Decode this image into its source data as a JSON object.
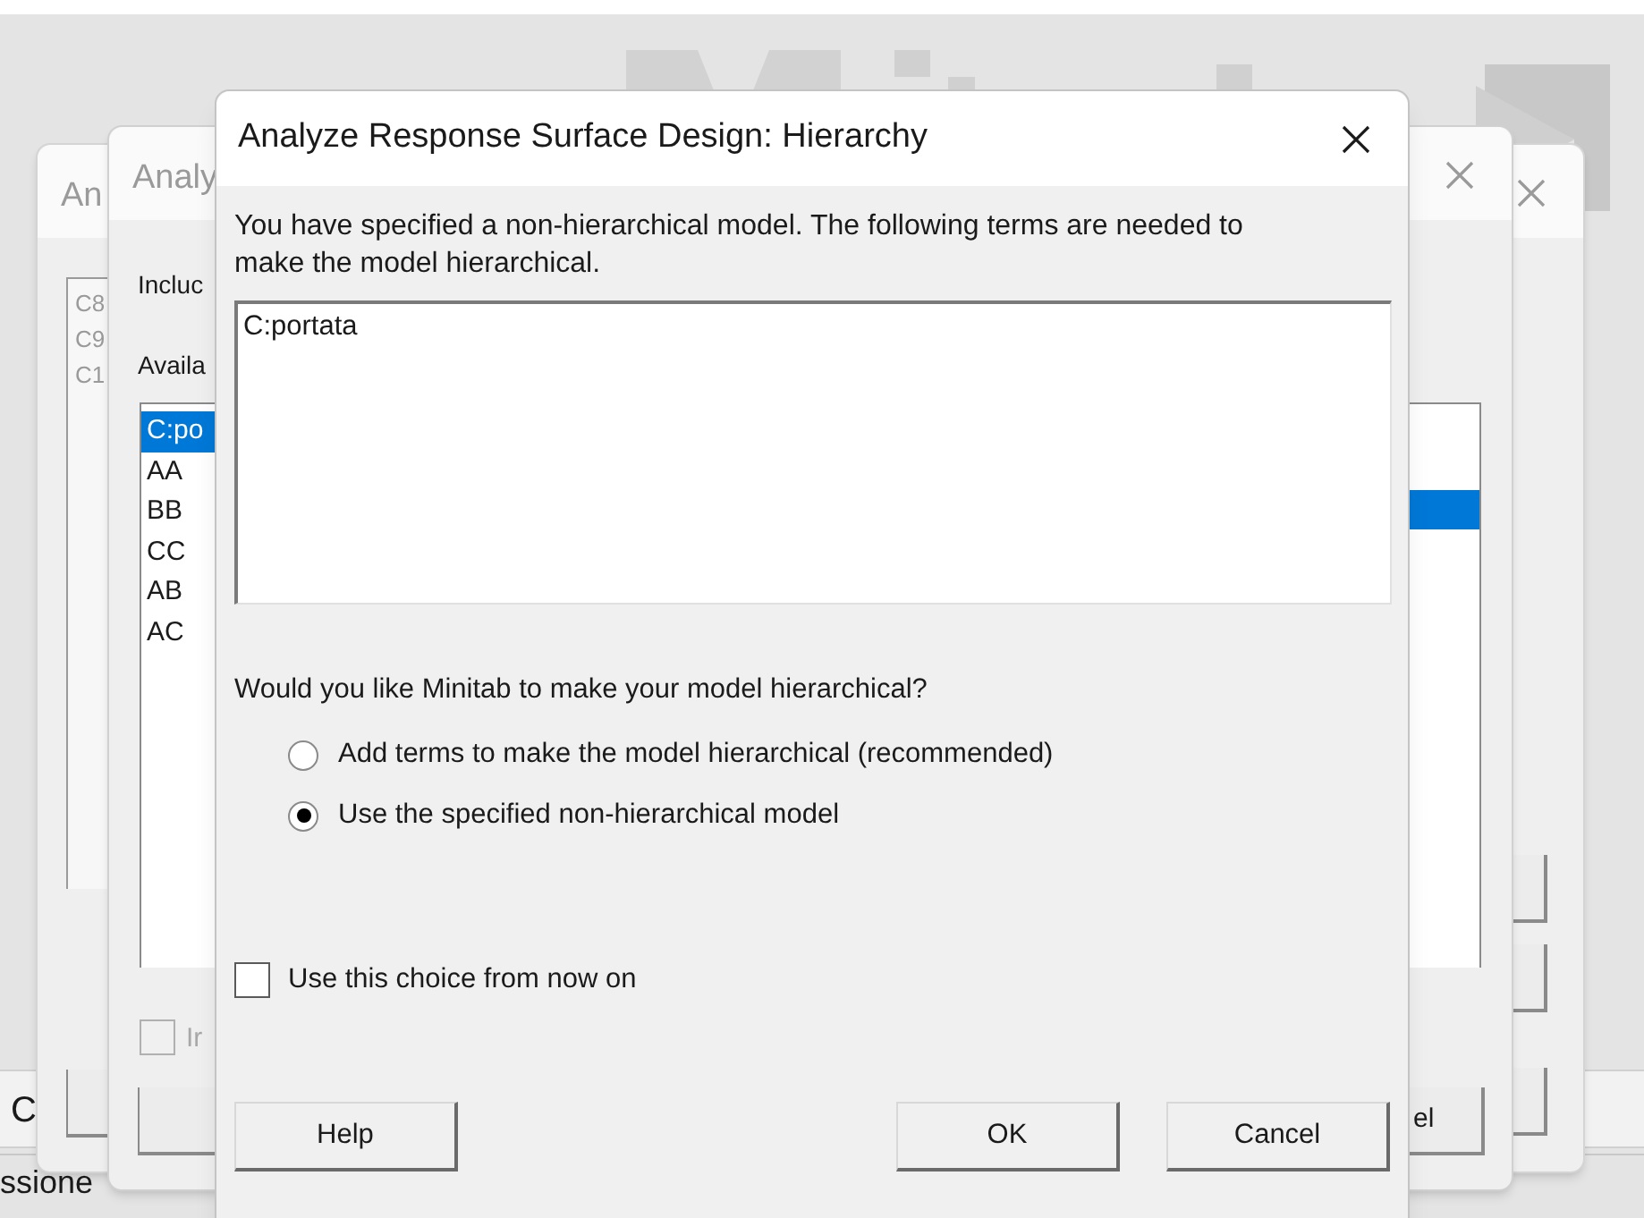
{
  "worksheet": {
    "column_header": "C",
    "tab_label": "ssione"
  },
  "back_window_1": {
    "title": "An",
    "list_items": [
      "C8",
      "C9",
      "C1"
    ]
  },
  "back_window_2": {
    "title": "Analy",
    "include_label": "Incluc",
    "available_label": "Availa",
    "available_items": [
      {
        "label": "C:po",
        "selected": true
      },
      {
        "label": "AA",
        "selected": false
      },
      {
        "label": "BB",
        "selected": false
      },
      {
        "label": "CC",
        "selected": false
      },
      {
        "label": "AB",
        "selected": false
      },
      {
        "label": "AC",
        "selected": false
      }
    ],
    "option": {
      "label": "Ir",
      "checked": false,
      "disabled": true
    },
    "cancel_button": "el"
  },
  "dialog": {
    "title": "Analyze Response Surface Design: Hierarchy",
    "message": "You have specified a non-hierarchical model. The following terms are needed to make the model hierarchical.",
    "terms": [
      "C:portata"
    ],
    "question": "Would you like Minitab to make your model hierarchical?",
    "options": [
      {
        "label": "Add terms to make the model hierarchical (recommended)",
        "selected": false
      },
      {
        "label": "Use the specified non-hierarchical model",
        "selected": true
      }
    ],
    "remember": {
      "label": "Use this choice from now on",
      "checked": false
    },
    "buttons": [
      {
        "label": "Help",
        "kind": "left"
      },
      {
        "label": "OK",
        "kind": "right"
      },
      {
        "label": "Cancel",
        "kind": "right"
      }
    ]
  }
}
